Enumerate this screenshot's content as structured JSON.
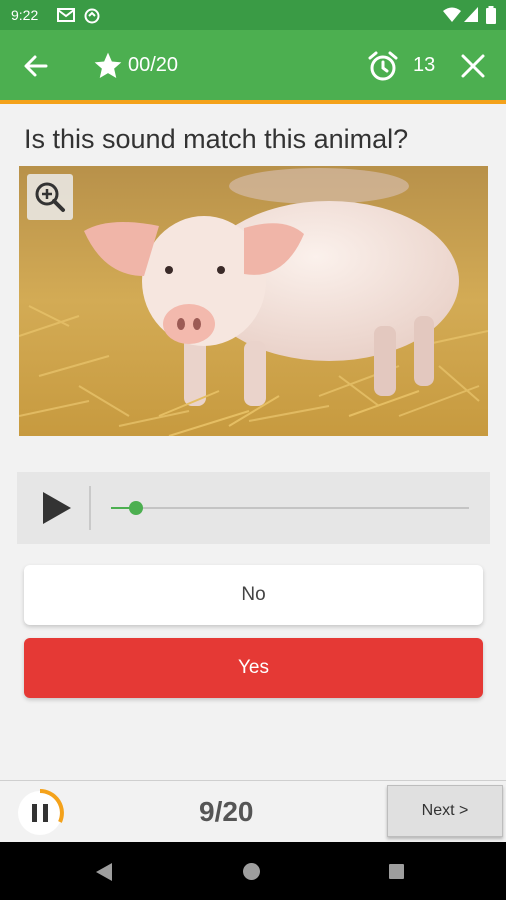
{
  "status_bar": {
    "time": "9:22",
    "icons": [
      "gmail-icon",
      "sync-icon",
      "wifi-icon",
      "signal-icon",
      "battery-icon"
    ]
  },
  "app_bar": {
    "score": "00/20",
    "timer": "13",
    "icons": [
      "back-arrow-icon",
      "star-icon",
      "alarm-clock-icon",
      "close-icon"
    ]
  },
  "quiz": {
    "question": "Is this sound match this animal?",
    "image_subject": "pig standing in straw",
    "audio": {
      "progress_fraction": 0.07
    },
    "answers": {
      "no_label": "No",
      "yes_label": "Yes"
    }
  },
  "bottom_bar": {
    "progress": "9/20",
    "next_label": "Next >"
  },
  "colors": {
    "accent_green": "#4caf50",
    "status_green": "#3a9b45",
    "accent_orange": "#f4a21b",
    "yes_red": "#e53935"
  }
}
